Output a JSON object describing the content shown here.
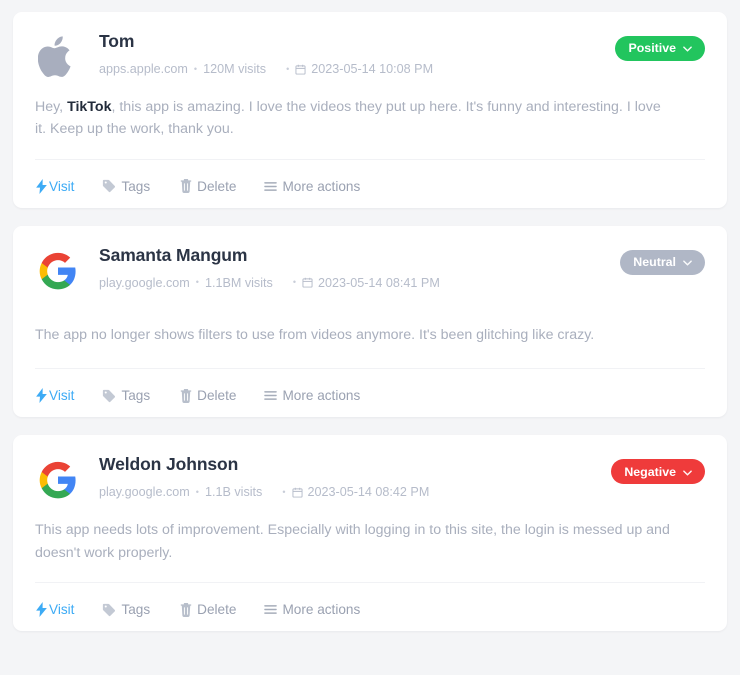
{
  "page": {
    "background": "#f4f5f7"
  },
  "actions": {
    "visit": "Visit",
    "tags": "Tags",
    "delete": "Delete",
    "more": "More actions"
  },
  "separator": "•",
  "sentiment_colors": {
    "positive": "#22c55e",
    "neutral": "#b0b7c6",
    "negative": "#ef3b3b"
  },
  "cards": [
    {
      "id": "card-tom",
      "logo": "apple-logo",
      "name": "Tom",
      "source": "apps.apple.com",
      "visits": "120M visits",
      "date": "2023-05-14 10:08 PM",
      "sentiment": "Positive",
      "sentiment_color": "#22c55e",
      "review_lead": "Hey, ",
      "review_bold": "TikTok",
      "review_rest": ", this app is amazing. I love the videos they put up here. It's funny and interesting. I love it. Keep up the work, thank you."
    },
    {
      "id": "card-samanta",
      "logo": "google-logo",
      "name": "Samanta Mangum",
      "source": "play.google.com",
      "visits": "1.1BM visits",
      "date": "2023-05-14 08:41 PM",
      "sentiment": "Neutral",
      "sentiment_color": "#b0b7c6",
      "review_lead": "",
      "review_bold": "",
      "review_rest": "The app no longer shows filters to use from videos anymore. It's been glitching like crazy."
    },
    {
      "id": "card-weldon",
      "logo": "google-logo",
      "name": "Weldon Johnson",
      "source": "play.google.com",
      "visits": "1.1B visits",
      "date": "2023-05-14 08:42 PM",
      "sentiment": "Negative",
      "sentiment_color": "#ef3b3b",
      "review_lead": "",
      "review_bold": "",
      "review_rest": "This app needs lots of improvement. Especially with logging in to this site, the login is messed up and doesn't work properly."
    }
  ]
}
